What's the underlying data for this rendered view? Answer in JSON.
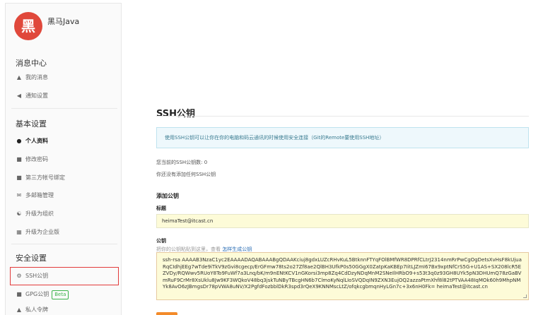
{
  "user": {
    "avatar_char": "黑",
    "name": "黑马Java"
  },
  "sidebar": {
    "sections": [
      {
        "title": "消息中心",
        "items": [
          {
            "icon": "bell-icon",
            "label": "我的消息"
          },
          {
            "icon": "speaker-icon",
            "label": "通知设置"
          }
        ]
      },
      {
        "title": "基本设置",
        "items": [
          {
            "icon": "user-icon",
            "label": "个人资料"
          },
          {
            "icon": "lock-icon",
            "label": "修改密码"
          },
          {
            "icon": "account-icon",
            "label": "第三方帐号绑定"
          },
          {
            "icon": "mail-icon",
            "label": "多邮箱管理"
          },
          {
            "icon": "group-icon",
            "label": "升级为组织"
          },
          {
            "icon": "building-icon",
            "label": "升级为企业版"
          }
        ]
      },
      {
        "title": "安全设置",
        "items": [
          {
            "icon": "key-icon",
            "label": "SSH公钥"
          },
          {
            "icon": "lock-icon",
            "label": "GPG公钥",
            "badge": "Beta"
          },
          {
            "icon": "people-icon",
            "label": "私人令牌"
          }
        ]
      }
    ]
  },
  "main": {
    "title": "SSH公钥",
    "info": "使用SSH公钥可以让你在你的电脑和码云通讯的时候使用安全连接（Git的Remote要使用SSH地址）",
    "count_text": "您当前的SSH公钥数: 0",
    "none_text": "你还没有添加任何SSH公钥",
    "add_heading": "添加公钥",
    "title_label": "标题",
    "title_value": "heimaTest@itcast.cn",
    "key_label": "公钥",
    "key_hint": "把你的公钥粘贴到这里，查看",
    "key_hint_link": "怎样生成公钥",
    "key_value": "ssh-rsa AAAAB3NzaC1yc2EAAAADAQABAAABgQDAAKciuj8gdxLUZcRHvKuL5BtknnFTYqFOlBMfWR8DPRfCLtrJ2314nmRrPwCgOgDetsXvHsF8kUjuaRqCIdhjEEg7wTde9iTkV9zGvi8cgecp/ErGFmw78ts2o27Zf8ae2QlBH3UfkP0s50GGgX0ZatpKaKBEp7IitLJZmI67Bx9xptNfCrS5G+U1AS+SX208lcR5EZVDy/RQWwv5RUoY8To9FuWf7a3Lnq/bK/m9nENtKCV1nGKorsi3mp8Zq4CdDzyNDqMnM2SNeIlHRbO9+s53t3q0z93GH8UYk5pN3DHUmQ78zGaBVmRuF9CrMr8XsUklu8Jw9KF3WQkoV48bq3jskTuNByTBcgHN6b7ClmoKyNqlLIoSVQDqIN9ZXN3EujOQ2azzaPtmXhf8l82tPTVAA48IqMOk60h9MhpNMYk8AvO6zJBmgsDr78pVWA8uNV/X2PgfdFozbblDkR3spd3rQeX9KNNMscLtZ/ofqkcgbmqnHyLGn7c+3x6nH0Fk= heimaTest@itcast.cn"
  },
  "colors": {
    "accent": "#e0483b",
    "selected_border": "#e23a3a",
    "beta": "#3bb34a",
    "link": "#2c6fb5",
    "button": "#f38b2a"
  }
}
